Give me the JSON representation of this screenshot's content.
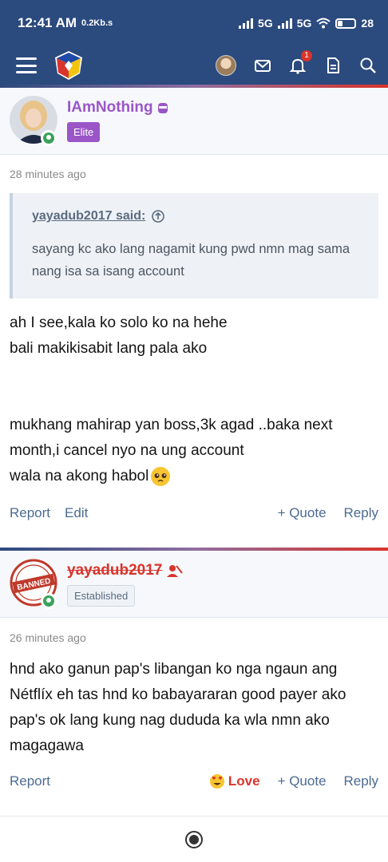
{
  "status": {
    "time": "12:41 AM",
    "speed": "0.2Kb.s",
    "net1": "5G",
    "net2": "5G",
    "battery": "28"
  },
  "nav": {
    "notification_count": "1"
  },
  "post1": {
    "username": "IAmNothing",
    "badge": "Elite",
    "time": "28 minutes ago",
    "quote_author": "yayadub2017 said:",
    "quote_text": "sayang kc ako lang nagamit kung pwd nmn mag sama nang isa sa isang account",
    "body_lines": [
      "ah I see,kala ko solo ko na hehe",
      "bali makikisabit lang pala ako",
      "",
      "",
      "mukhang mahirap yan boss,3k agad ..baka next month,i cancel nyo na ung account",
      "wala na akong habol"
    ],
    "actions": {
      "report": "Report",
      "edit": "Edit",
      "quote": "+ Quote",
      "reply": "Reply"
    }
  },
  "post2": {
    "username": "yayadub2017",
    "badge": "Established",
    "time": "26 minutes ago",
    "body": "hnd ako ganun pap's libangan ko nga ngaun ang Nétflíx eh tas hnd ko babayararan good payer ako pap's ok lang kung nag dududa ka wla nmn ako magagawa",
    "actions": {
      "report": "Report",
      "love": "Love",
      "quote": "+ Quote",
      "reply": "Reply"
    }
  }
}
